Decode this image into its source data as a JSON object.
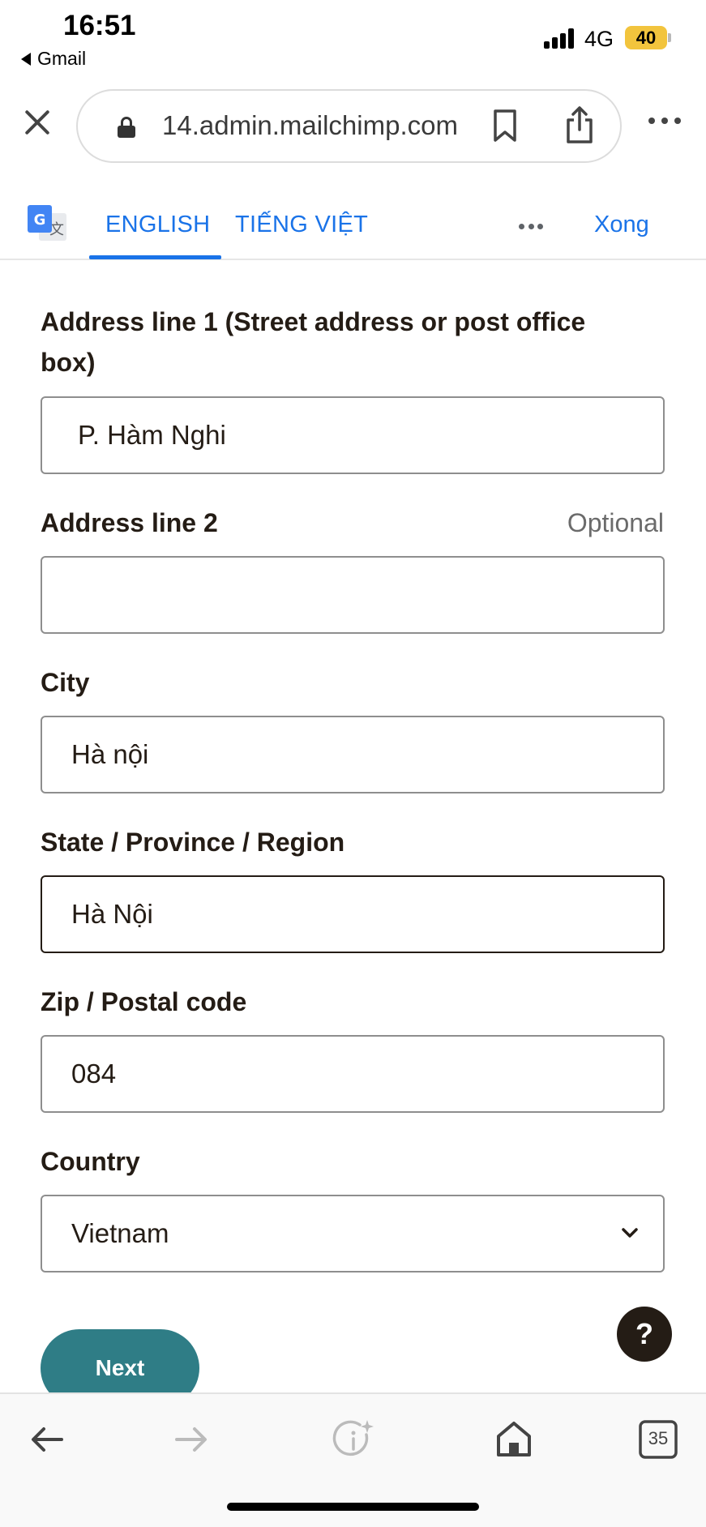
{
  "status_bar": {
    "time": "16:51",
    "back_app": "Gmail",
    "network": "4G",
    "battery": "40"
  },
  "browser": {
    "url": "14.admin.mailchimp.com"
  },
  "translate_bar": {
    "tab_english": "ENGLISH",
    "tab_vietnamese": "TIẾNG VIỆT",
    "done_label": "Xong"
  },
  "form": {
    "address1_label": "Address line 1 (Street address or post office box)",
    "address1_value": "P. Hàm Nghi",
    "address2_label": "Address line 2",
    "address2_optional": "Optional",
    "address2_value": "",
    "city_label": "City",
    "city_value": "Hà nội",
    "state_label": "State / Province / Region",
    "state_value": "Hà Nội",
    "zip_label": "Zip / Postal code",
    "zip_value": "084",
    "country_label": "Country",
    "country_value": "Vietnam",
    "next_label": "Next",
    "help_label": "?"
  },
  "toolbar": {
    "tabs_count": "35"
  },
  "colors": {
    "accent_blue": "#1a73e8",
    "next_button": "#2f7d86",
    "text_dark": "#241c15",
    "battery": "#f2c43d"
  }
}
